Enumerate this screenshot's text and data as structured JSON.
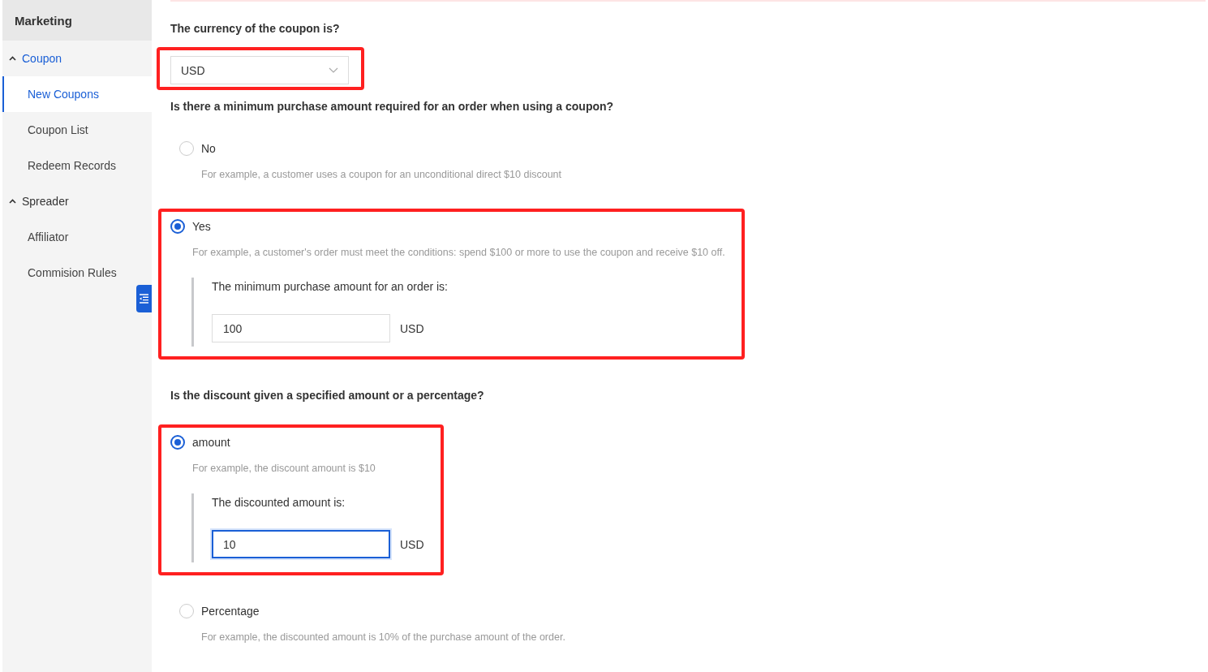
{
  "sidebar": {
    "title": "Marketing",
    "groups": [
      {
        "label": "Coupon",
        "expanded": true,
        "items": [
          {
            "label": "New Coupons",
            "selected": true
          },
          {
            "label": "Coupon List",
            "selected": false
          },
          {
            "label": "Redeem Records",
            "selected": false
          }
        ]
      },
      {
        "label": "Spreader",
        "expanded": true,
        "items": [
          {
            "label": "Affiliator",
            "selected": false
          },
          {
            "label": "Commision Rules",
            "selected": false
          }
        ]
      }
    ]
  },
  "form": {
    "sections": [
      {
        "kind": "select",
        "question": "The currency of the coupon is?",
        "value": "USD",
        "highlighted": true
      },
      {
        "kind": "radio",
        "question": "Is there a minimum purchase amount required for an order when using a coupon?",
        "options": [
          {
            "label": "No",
            "hint": "For example, a customer uses a coupon for an unconditional direct $10 discount",
            "selected": false,
            "highlighted": false
          },
          {
            "label": "Yes",
            "hint": "For example, a customer's order must meet the conditions: spend $100 or more to use the coupon and receive $10 off.",
            "selected": true,
            "highlighted": true,
            "field": {
              "label": "The minimum purchase amount for an order is:",
              "value": "100",
              "unit": "USD",
              "focused": false
            }
          }
        ]
      },
      {
        "kind": "radio",
        "question": "Is the discount given a specified amount or a percentage?",
        "options": [
          {
            "label": "amount",
            "hint": "For example, the discount amount is $10",
            "selected": true,
            "highlighted": true,
            "field": {
              "label": "The discounted amount is:",
              "value": "10",
              "unit": "USD",
              "focused": true
            }
          },
          {
            "label": "Percentage",
            "hint": "For example, the discounted amount is 10% of the purchase amount of the order.",
            "selected": false,
            "highlighted": false
          }
        ]
      }
    ]
  }
}
